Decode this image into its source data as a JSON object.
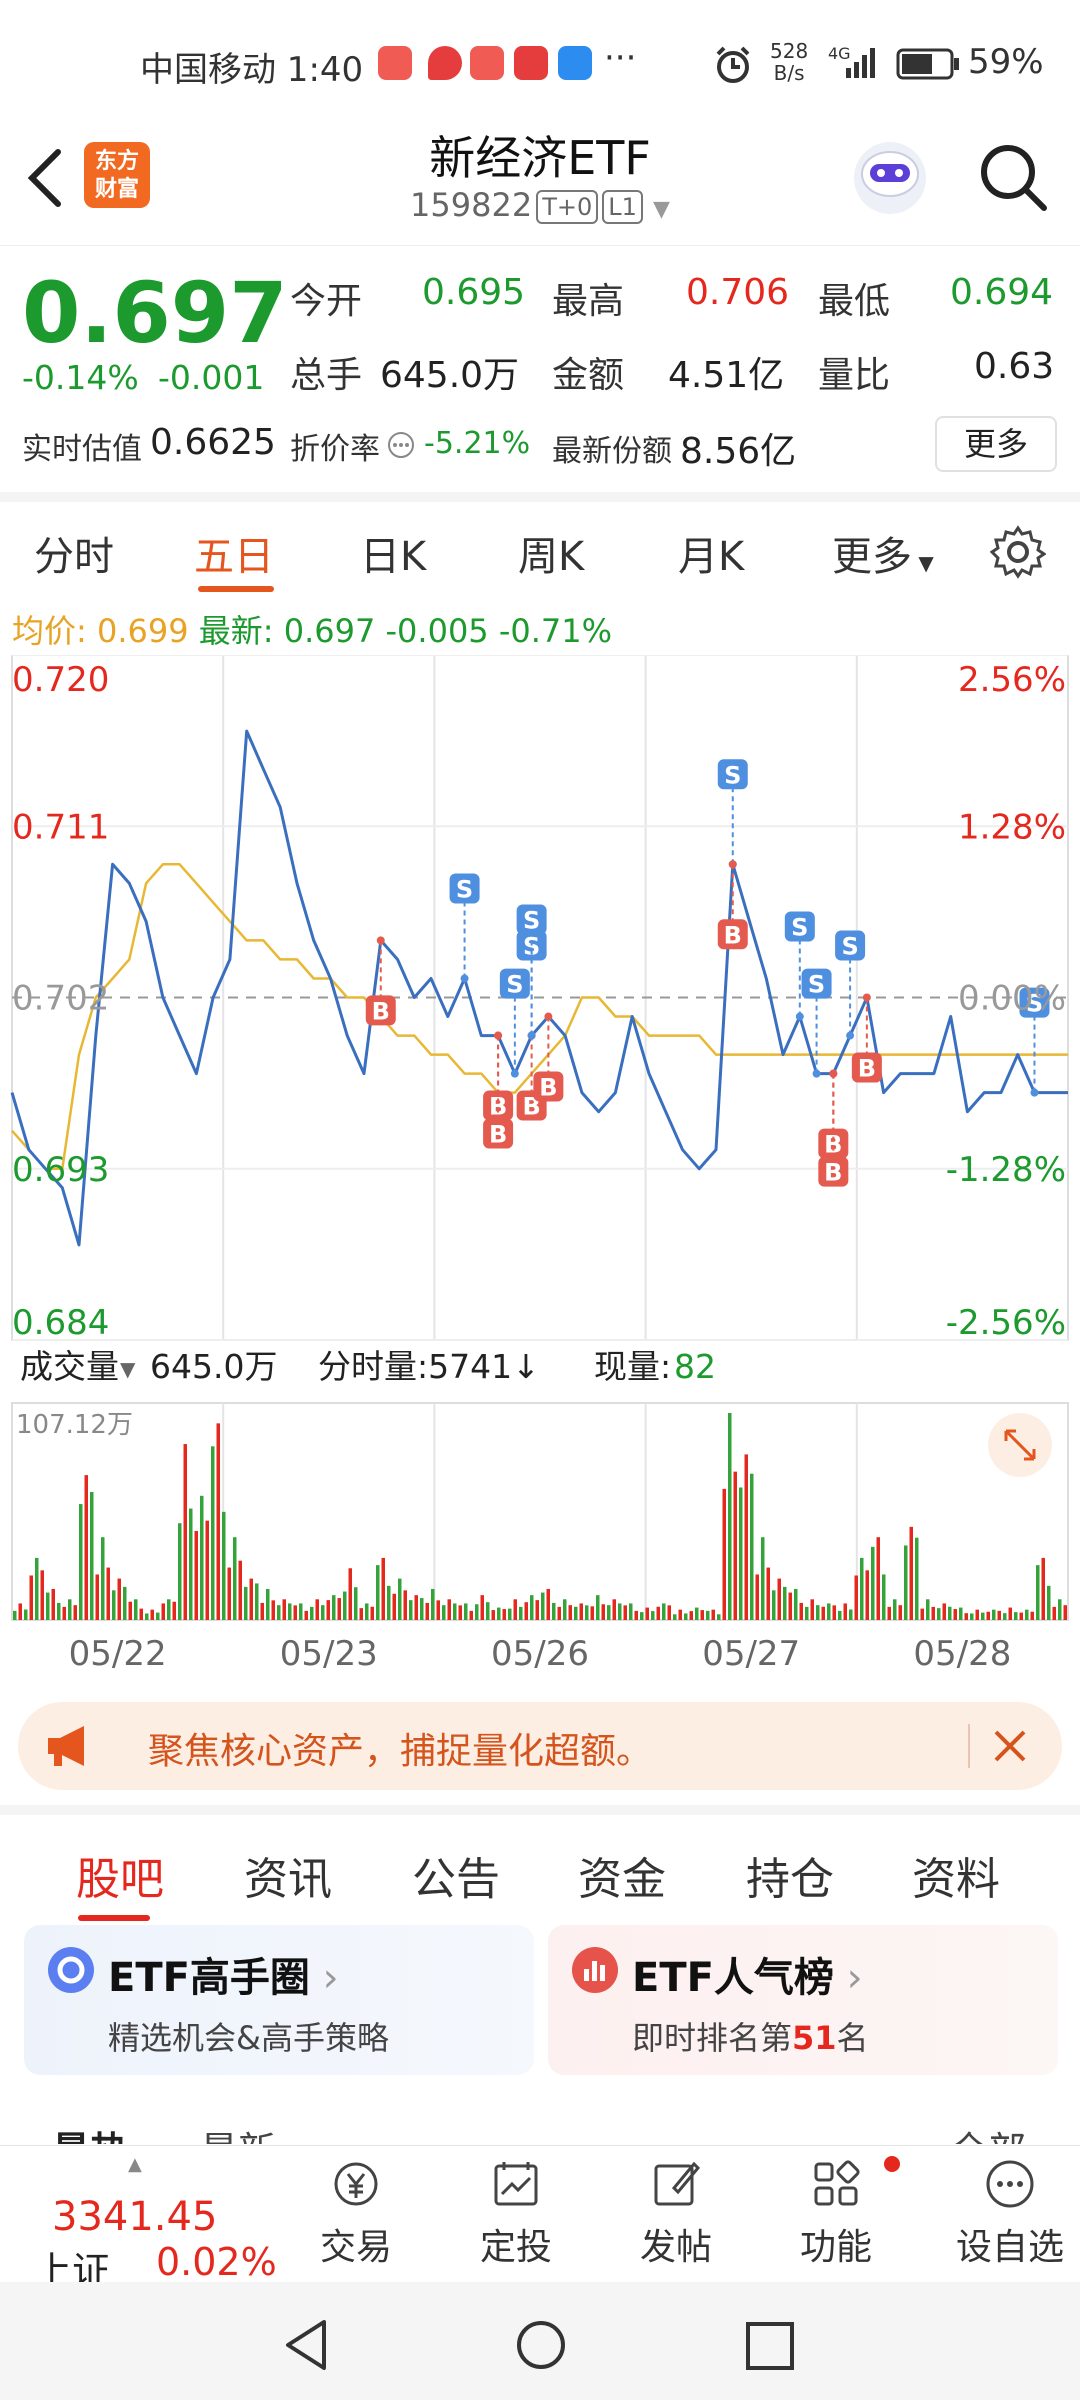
{
  "status_bar": {
    "carrier_time": "中国移动 1:40",
    "dots": "···",
    "net_speed_top": "528",
    "net_speed_bottom": "B/s",
    "network": "4G",
    "battery": "59%"
  },
  "header": {
    "logo_line1": "东方",
    "logo_line2": "财富",
    "title": "新经济ETF",
    "code": "159822",
    "tag1": "T+0",
    "tag2": "L1"
  },
  "quote": {
    "price": "0.697",
    "change_pct": "-0.14%",
    "change": "-0.001",
    "open_label": "今开",
    "open": "0.695",
    "high_label": "最高",
    "high": "0.706",
    "low_label": "最低",
    "low": "0.694",
    "volume_label": "总手",
    "volume": "645.0万",
    "amount_label": "金额",
    "amount": "4.51亿",
    "ratio_label": "量比",
    "ratio": "0.63",
    "iopv_label": "实时估值",
    "iopv": "0.6625",
    "discount_label": "折价率",
    "discount": "-5.21%",
    "shares_label": "最新份额",
    "shares": "8.56亿",
    "more": "更多"
  },
  "chart_tabs": [
    "分时",
    "五日",
    "日K",
    "周K",
    "月K",
    "更多"
  ],
  "avg_line": {
    "avg_label": "均价:",
    "avg": "0.699",
    "latest_label": "最新:",
    "latest": "0.697",
    "chg": "-0.005",
    "pct": "-0.71%"
  },
  "chart_data": {
    "type": "line",
    "x": [
      "05/22",
      "05/23",
      "05/26",
      "05/27",
      "05/28"
    ],
    "ylim": [
      0.684,
      0.72
    ],
    "left_ticks": [
      "0.720",
      "0.711",
      "0.702",
      "0.693",
      "0.684"
    ],
    "right_ticks": [
      "2.56%",
      "1.28%",
      "0.00%",
      "-1.28%",
      "-2.56%"
    ],
    "series": [
      {
        "values": [
          0.697,
          0.694,
          0.693,
          0.692,
          0.689,
          0.7,
          0.709,
          0.708,
          0.706,
          0.702,
          0.7,
          0.698,
          0.702,
          0.704,
          0.716,
          0.714,
          0.712,
          0.708,
          0.705,
          0.703,
          0.7,
          0.698,
          0.705,
          0.704,
          0.702,
          0.703,
          0.701,
          0.703,
          0.7,
          0.7,
          0.698,
          0.7,
          0.701,
          0.7,
          0.697,
          0.696,
          0.697,
          0.701,
          0.698,
          0.696,
          0.694,
          0.693,
          0.694,
          0.709,
          0.706,
          0.703,
          0.699,
          0.701,
          0.698,
          0.698,
          0.7,
          0.702,
          0.697,
          0.698,
          0.698,
          0.698,
          0.701,
          0.696,
          0.697,
          0.697,
          0.699,
          0.697,
          0.697,
          0.697
        ]
      },
      {
        "values": [
          0.695,
          0.694,
          0.693,
          0.693,
          0.699,
          0.702,
          0.703,
          0.704,
          0.708,
          0.709,
          0.709,
          0.708,
          0.707,
          0.706,
          0.705,
          0.705,
          0.704,
          0.704,
          0.703,
          0.703,
          0.702,
          0.702,
          0.701,
          0.7,
          0.7,
          0.699,
          0.699,
          0.698,
          0.698,
          0.697,
          0.697,
          0.698,
          0.699,
          0.7,
          0.702,
          0.702,
          0.701,
          0.701,
          0.7,
          0.7,
          0.7,
          0.7,
          0.699,
          0.699,
          0.699,
          0.699,
          0.699,
          0.699,
          0.699,
          0.699,
          0.699,
          0.699,
          0.699,
          0.699,
          0.699,
          0.699,
          0.699,
          0.699,
          0.699,
          0.699,
          0.699,
          0.699,
          0.699,
          0.699
        ]
      }
    ],
    "volume_label": "成交量",
    "volume_total": "645.0万",
    "tick_volume_label": "分时量:5741↓",
    "current_volume_label": "现量:",
    "current_volume": "82",
    "volume_max": "107.12万",
    "volumes": [
      8,
      30,
      15,
      10,
      70,
      40,
      20,
      10,
      5,
      10,
      85,
      60,
      95,
      40,
      20,
      15,
      10,
      8,
      10,
      12,
      25,
      8,
      30,
      20,
      12,
      15,
      10,
      8,
      12,
      6,
      10,
      12,
      15,
      10,
      8,
      12,
      10,
      8,
      6,
      8,
      5,
      6,
      5,
      100,
      80,
      40,
      20,
      15,
      10,
      8,
      8,
      30,
      40,
      10,
      45,
      10,
      8,
      6,
      5,
      5,
      6,
      5,
      30,
      10
    ],
    "buy_markers_label": "B",
    "sell_markers_label": "S"
  },
  "banner": {
    "text": "聚焦核心资产，捕捉量化超额。"
  },
  "bottom_tabs": [
    "股吧",
    "资讯",
    "公告",
    "资金",
    "持仓",
    "资料"
  ],
  "cards": [
    {
      "title": "ETF高手圈",
      "sub": "精选机会&高手策略"
    },
    {
      "title": "ETF人气榜",
      "sub_prefix": "即时排名第",
      "rank": "51",
      "sub_suffix": "名"
    }
  ],
  "peek": {
    "left": "最热",
    "left2": "最新",
    "right": "全部"
  },
  "index": {
    "value": "3341.45",
    "name": "上证",
    "pct": "0.02%"
  },
  "toolbar": [
    "交易",
    "定投",
    "发帖",
    "功能",
    "设自选"
  ]
}
